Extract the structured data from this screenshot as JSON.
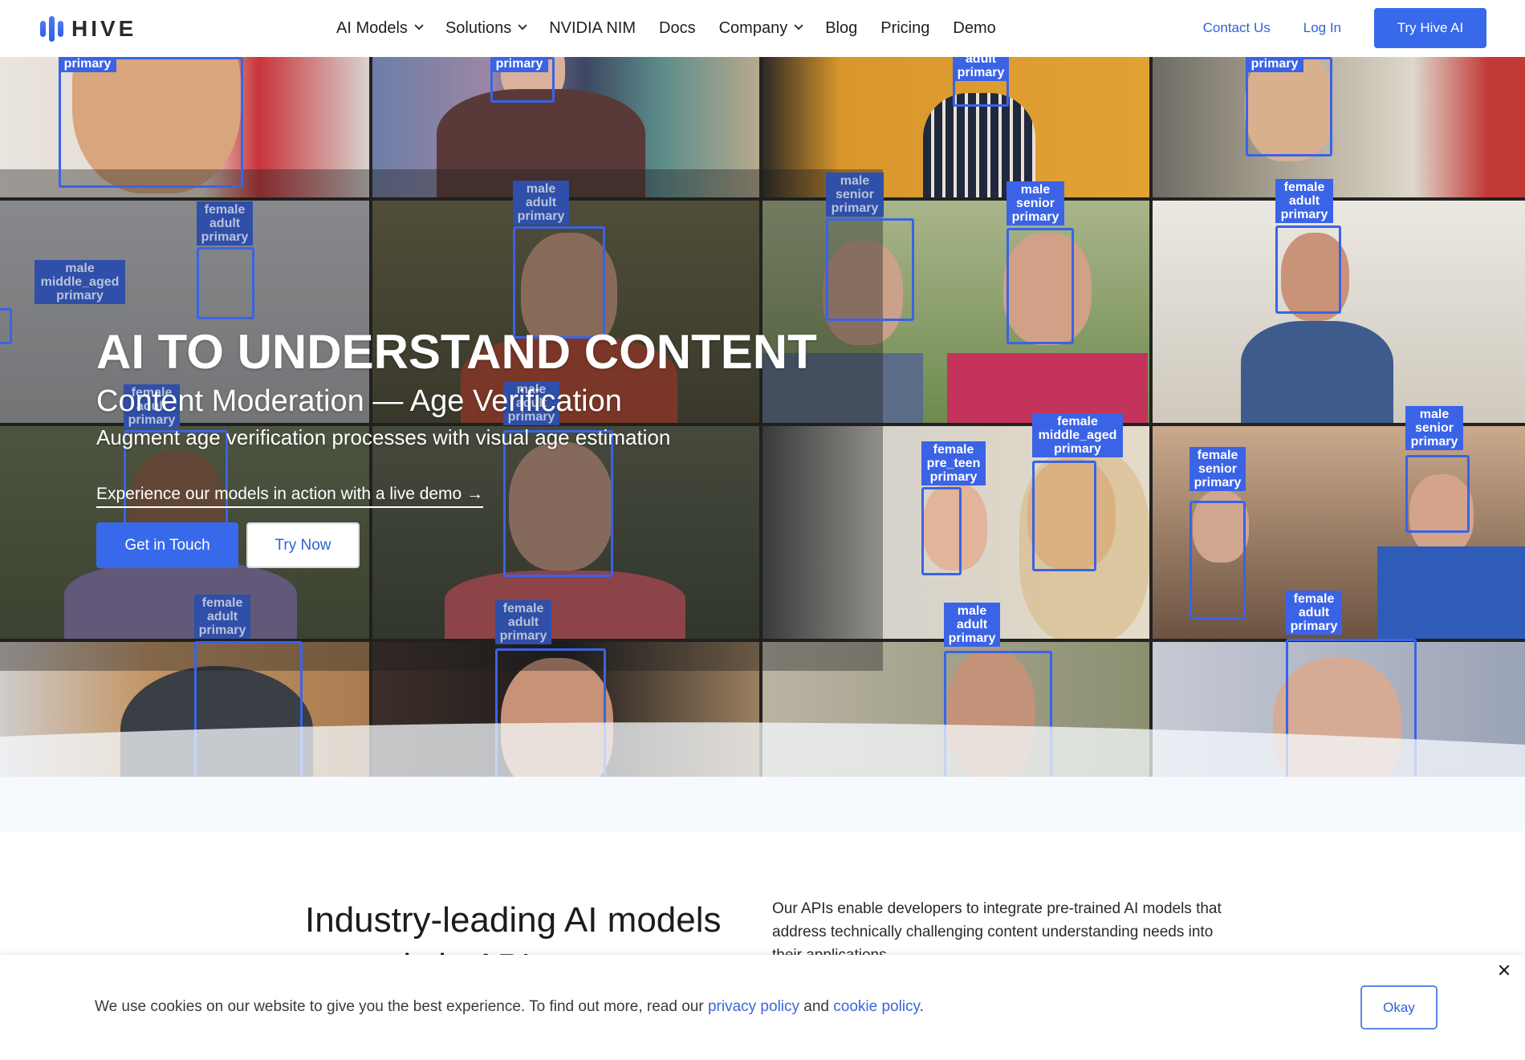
{
  "brand": {
    "name": "HIVE",
    "accent": "#3769ea",
    "link_color": "#2f62d8",
    "detection_box_color": "#3a63e6"
  },
  "nav": {
    "links": [
      {
        "label": "AI Models",
        "dropdown": true
      },
      {
        "label": "Solutions",
        "dropdown": true
      },
      {
        "label": "NVIDIA NIM",
        "dropdown": false
      },
      {
        "label": "Docs",
        "dropdown": false
      },
      {
        "label": "Company",
        "dropdown": true
      },
      {
        "label": "Blog",
        "dropdown": false
      },
      {
        "label": "Pricing",
        "dropdown": false
      },
      {
        "label": "Demo",
        "dropdown": false
      }
    ],
    "contact_label": "Contact Us",
    "login_label": "Log In",
    "cta_label": "Try Hive AI"
  },
  "hero": {
    "title": "AI TO UNDERSTAND CONTENT",
    "subtitle": "Content Moderation — Age Verification",
    "description": "Augment age verification processes with visual age estimation",
    "demo_link": "Experience our models in action with a live demo →",
    "primary_button": "Get in Touch",
    "secondary_button": "Try Now",
    "detections": [
      {
        "label": "primary"
      },
      {
        "label": "primary"
      },
      {
        "label": "adult\nprimary"
      },
      {
        "label": "primary"
      },
      {
        "label": "female\nadult\nprimary"
      },
      {
        "label": "male\nadult\nprimary"
      },
      {
        "label": "male\nsenior\nprimary"
      },
      {
        "label": "male\nsenior\nprimary"
      },
      {
        "label": "female\nadult\nprimary"
      },
      {
        "label": "male\nmiddle_aged\nprimary"
      },
      {
        "label": "female\nadult\nprimary"
      },
      {
        "label": "male\nadult\nprimary"
      },
      {
        "label": "female\npre_teen\nprimary"
      },
      {
        "label": "female\nmiddle_aged\nprimary"
      },
      {
        "label": "female\nsenior\nprimary"
      },
      {
        "label": "male\nsenior\nprimary"
      },
      {
        "label": "female\nadult\nprimary"
      },
      {
        "label": "female\nadult\nprimary"
      },
      {
        "label": "male\nadult\nprimary"
      },
      {
        "label": "female\nadult\nprimary"
      }
    ]
  },
  "intro": {
    "title": "Industry-leading AI models served via APIs",
    "text": "Our APIs enable developers to integrate pre-trained AI models that address technically challenging content understanding needs into their applications."
  },
  "cookie": {
    "text_before": "We use cookies on our website to give you the best experience. To find out more, read our ",
    "privacy_link": "privacy policy",
    "text_mid": " and ",
    "cookie_link": "cookie policy",
    "text_after": ".",
    "okay_label": "Okay",
    "close_icon": "close-icon"
  }
}
